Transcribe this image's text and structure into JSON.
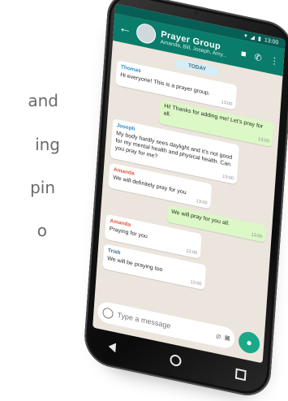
{
  "side_text": [
    "and",
    "ing",
    "pin",
    "o"
  ],
  "status": {
    "time": "13:00"
  },
  "header": {
    "title": "Prayer Group",
    "subtitle": "Amanda, Bill, Joseph, Amy..."
  },
  "chat": {
    "date_chip": "TODAY",
    "messages": [
      {
        "side": "in",
        "sender": "Thomas",
        "text": "Hi everyone! This is a prayer group.",
        "time": "13:00"
      },
      {
        "side": "out",
        "sender": "",
        "text": "Hi! Thanks for adding me! Let's pray for all.",
        "time": "13:00"
      },
      {
        "side": "in",
        "sender": "Joseph",
        "text": "My body hardly sees daylight and it's not good for my mental health and physical health. Can you pray for me?",
        "time": "13:00"
      },
      {
        "side": "in",
        "sender": "Amanda",
        "text": "We will definitely pray for you",
        "time": "13:00"
      },
      {
        "side": "out",
        "sender": "",
        "text": "We will pray for you all.",
        "time": "13:00"
      },
      {
        "side": "in",
        "sender": "Amanda",
        "text": "Praying for you",
        "time": "13:00"
      },
      {
        "side": "in",
        "sender": "Trish",
        "text": "We will be praying too",
        "time": "13:00"
      }
    ]
  },
  "composer": {
    "placeholder": "Type a message"
  },
  "colors": {
    "header": "#0a7c6b",
    "status": "#075e54",
    "chat_bg": "#ece5dd",
    "outgoing": "#dcf8c6",
    "mic": "#1aa988"
  },
  "icons": [
    "back-arrow-icon",
    "video-icon",
    "phone-icon",
    "more-vert-icon",
    "emoji-icon",
    "attach-icon",
    "camera-icon",
    "mic-icon"
  ]
}
